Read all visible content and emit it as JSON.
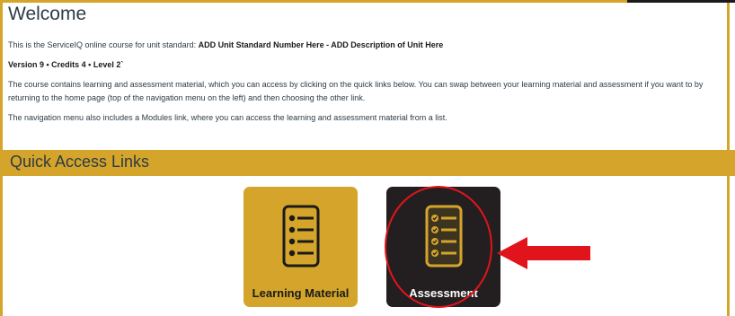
{
  "page": {
    "title": "Welcome",
    "intro_prefix": "This is the ServiceIQ online course for unit standard: ",
    "intro_bold": "ADD Unit Standard Number Here - ADD Description of Unit Here",
    "version_line": "Version 9 • Credits 4 • Level 2`",
    "para1": "The course contains learning and assessment material, which you can access by clicking on the quick links below. You can swap between your learning material and assessment if you want to by returning to the home page (top of the navigation menu on the left) and then choosing the other link.",
    "para2": "The navigation menu also includes a Modules link, where you can access the learning and assessment material from a list."
  },
  "quick_access": {
    "heading": "Quick Access Links",
    "tiles": [
      {
        "label": "Learning Material",
        "icon": "list-icon"
      },
      {
        "label": "Assessment",
        "icon": "checklist-icon"
      }
    ]
  },
  "colors": {
    "gold": "#d4a52a",
    "dark": "#231f20",
    "annotation_red": "#e2141b"
  }
}
